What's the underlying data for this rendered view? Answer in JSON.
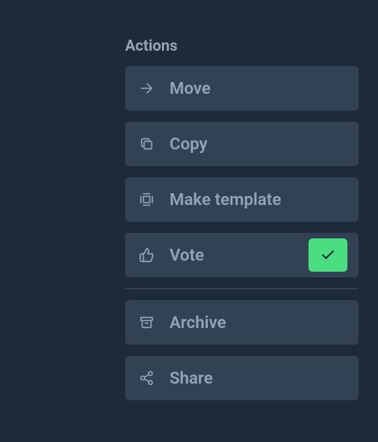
{
  "actions": {
    "title": "Actions",
    "items": [
      {
        "label": "Move"
      },
      {
        "label": "Copy"
      },
      {
        "label": "Make template"
      },
      {
        "label": "Vote"
      },
      {
        "label": "Archive"
      },
      {
        "label": "Share"
      }
    ]
  }
}
